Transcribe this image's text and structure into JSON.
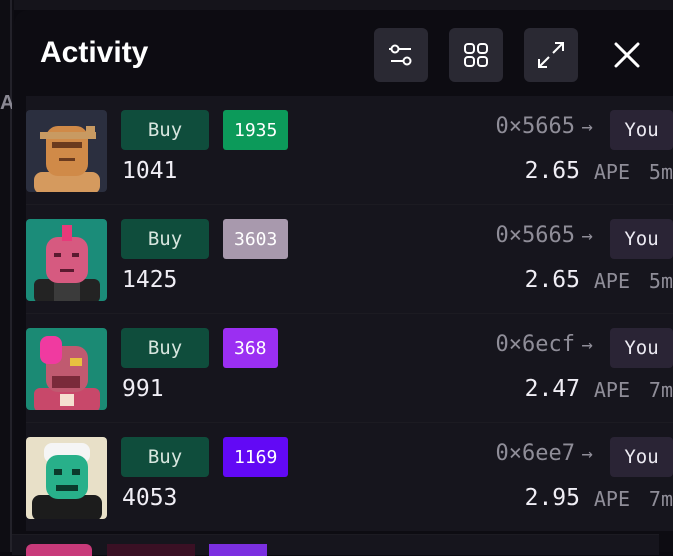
{
  "edge": {
    "letter": "A"
  },
  "header": {
    "title": "Activity"
  },
  "buttons": {
    "filter_icon": "sliders-icon",
    "grid_icon": "grid-icon",
    "expand_icon": "expand-icon",
    "close_icon": "close-icon"
  },
  "rows": [
    {
      "action": "Buy",
      "token": "1935",
      "token_color": "#0c9a5a",
      "id": "1041",
      "from": "0×5665",
      "to": "You",
      "price": "2.65",
      "currency": "APE",
      "age": "5m"
    },
    {
      "action": "Buy",
      "token": "3603",
      "token_color": "#a899ad",
      "id": "1425",
      "from": "0×5665",
      "to": "You",
      "price": "2.65",
      "currency": "APE",
      "age": "5m"
    },
    {
      "action": "Buy",
      "token": "368",
      "token_color": "#9b2ff2",
      "id": "991",
      "from": "0×6ecf",
      "to": "You",
      "price": "2.47",
      "currency": "APE",
      "age": "7m"
    },
    {
      "action": "Buy",
      "token": "1169",
      "token_color": "#6209f5",
      "id": "4053",
      "from": "0×6ee7",
      "to": "You",
      "price": "2.95",
      "currency": "APE",
      "age": "7m"
    }
  ]
}
